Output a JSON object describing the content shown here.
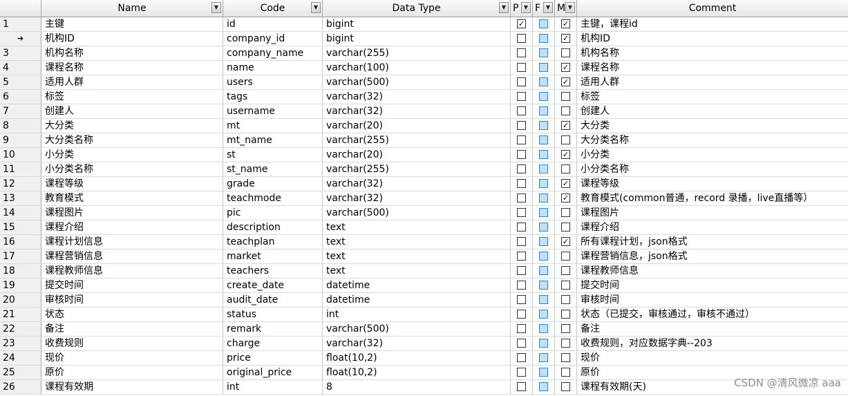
{
  "columns": {
    "name": "Name",
    "code": "Code",
    "data_type": "Data Type",
    "p": "P",
    "f": "F",
    "m": "M",
    "comment": "Comment"
  },
  "current_row_marker": "➔",
  "rows": [
    {
      "num": "1",
      "name": "主键",
      "code": "id",
      "type": "bigint",
      "p": true,
      "m": true,
      "comment": "主键，课程id"
    },
    {
      "num": "",
      "name": "机构ID",
      "code": "company_id",
      "type": "bigint",
      "p": false,
      "m": true,
      "comment": "机构ID"
    },
    {
      "num": "3",
      "name": "机构名称",
      "code": "company_name",
      "type": "varchar(255)",
      "p": false,
      "m": false,
      "comment": "机构名称"
    },
    {
      "num": "4",
      "name": "课程名称",
      "code": "name",
      "type": "varchar(100)",
      "p": false,
      "m": true,
      "comment": "课程名称"
    },
    {
      "num": "5",
      "name": "适用人群",
      "code": "users",
      "type": "varchar(500)",
      "p": false,
      "m": true,
      "comment": "适用人群"
    },
    {
      "num": "6",
      "name": "标签",
      "code": "tags",
      "type": "varchar(32)",
      "p": false,
      "m": false,
      "comment": "标签"
    },
    {
      "num": "7",
      "name": "创建人",
      "code": "username",
      "type": "varchar(32)",
      "p": false,
      "m": false,
      "comment": "创建人"
    },
    {
      "num": "8",
      "name": "大分类",
      "code": "mt",
      "type": "varchar(20)",
      "p": false,
      "m": true,
      "comment": "大分类"
    },
    {
      "num": "9",
      "name": "大分类名称",
      "code": "mt_name",
      "type": "varchar(255)",
      "p": false,
      "m": false,
      "comment": "大分类名称"
    },
    {
      "num": "10",
      "name": "小分类",
      "code": "st",
      "type": "varchar(20)",
      "p": false,
      "m": true,
      "comment": "小分类"
    },
    {
      "num": "11",
      "name": "小分类名称",
      "code": "st_name",
      "type": "varchar(255)",
      "p": false,
      "m": false,
      "comment": "小分类名称"
    },
    {
      "num": "12",
      "name": "课程等级",
      "code": "grade",
      "type": "varchar(32)",
      "p": false,
      "m": true,
      "comment": "课程等级"
    },
    {
      "num": "13",
      "name": "教育模式",
      "code": "teachmode",
      "type": "varchar(32)",
      "p": false,
      "m": true,
      "comment": "教育模式(common普通，record 录播，live直播等）"
    },
    {
      "num": "14",
      "name": "课程图片",
      "code": "pic",
      "type": "varchar(500)",
      "p": false,
      "m": false,
      "comment": "课程图片"
    },
    {
      "num": "15",
      "name": "课程介绍",
      "code": "description",
      "type": "text",
      "p": false,
      "m": false,
      "comment": "课程介绍"
    },
    {
      "num": "16",
      "name": "课程计划信息",
      "code": "teachplan",
      "type": "text",
      "p": false,
      "m": true,
      "comment": "所有课程计划，json格式"
    },
    {
      "num": "17",
      "name": "课程营销信息",
      "code": "market",
      "type": "text",
      "p": false,
      "m": false,
      "comment": "课程营销信息，json格式"
    },
    {
      "num": "18",
      "name": "课程教师信息",
      "code": "teachers",
      "type": "text",
      "p": false,
      "m": false,
      "comment": "课程教师信息"
    },
    {
      "num": "19",
      "name": "提交时间",
      "code": "create_date",
      "type": "datetime",
      "p": false,
      "m": false,
      "comment": "提交时间"
    },
    {
      "num": "20",
      "name": "审核时间",
      "code": "audit_date",
      "type": "datetime",
      "p": false,
      "m": false,
      "comment": "审核时间"
    },
    {
      "num": "21",
      "name": "状态",
      "code": "status",
      "type": "int",
      "p": false,
      "m": false,
      "comment": "状态（已提交，审核通过，审核不通过）"
    },
    {
      "num": "22",
      "name": "备注",
      "code": "remark",
      "type": "varchar(500)",
      "p": false,
      "m": false,
      "comment": "备注"
    },
    {
      "num": "23",
      "name": "收费规则",
      "code": "charge",
      "type": "varchar(32)",
      "p": false,
      "m": false,
      "comment": "收费规则，对应数据字典--203"
    },
    {
      "num": "24",
      "name": "现价",
      "code": "price",
      "type": "float(10,2)",
      "p": false,
      "m": false,
      "comment": "现价"
    },
    {
      "num": "25",
      "name": "原价",
      "code": "original_price",
      "type": "float(10,2)",
      "p": false,
      "m": false,
      "comment": "原价"
    },
    {
      "num": "26",
      "name": "课程有效期",
      "code": "int",
      "type": "8",
      "p": false,
      "m": false,
      "comment": "课程有效期(天)"
    }
  ],
  "watermark": "CSDN @清风微凉 aaa",
  "icons": {
    "dropdown": "chevron-down-icon",
    "checked": "check-icon",
    "current_row": "arrow-right-icon"
  },
  "colors": {
    "header_bg": "#e6e6e6",
    "f_checkbox": "#bfe0f8",
    "grid_line": "#d9d9d9"
  }
}
